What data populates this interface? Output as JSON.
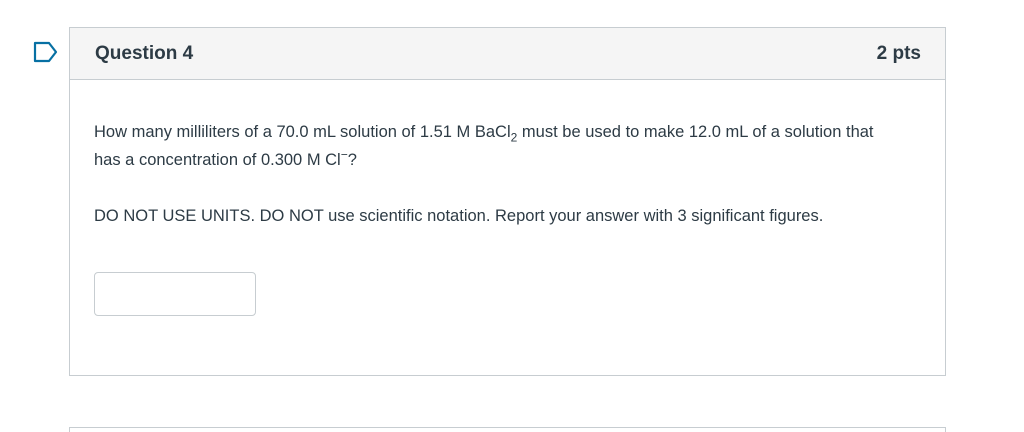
{
  "question": {
    "title": "Question 4",
    "points": "2 pts",
    "text_parts": {
      "p1": "How many milliliters of a 70.0 mL solution of 1.51 M BaCl",
      "p1_sub": "2",
      "p2": " must be used to make 12.0 mL of a solution that has a concentration of 0.300 M Cl",
      "p2_sup": "−",
      "p3": "?"
    },
    "instruction": "DO NOT USE UNITS. DO NOT use scientific notation. Report your answer with 3 significant figures.",
    "answer": {
      "value": "",
      "placeholder": ""
    }
  },
  "colors": {
    "flag_blue": "#0770a3",
    "border": "#c7cdd1",
    "header_bg": "#f5f5f5",
    "text": "#2d3b45"
  },
  "icons": {
    "flag": "bookmark-flag-icon"
  }
}
